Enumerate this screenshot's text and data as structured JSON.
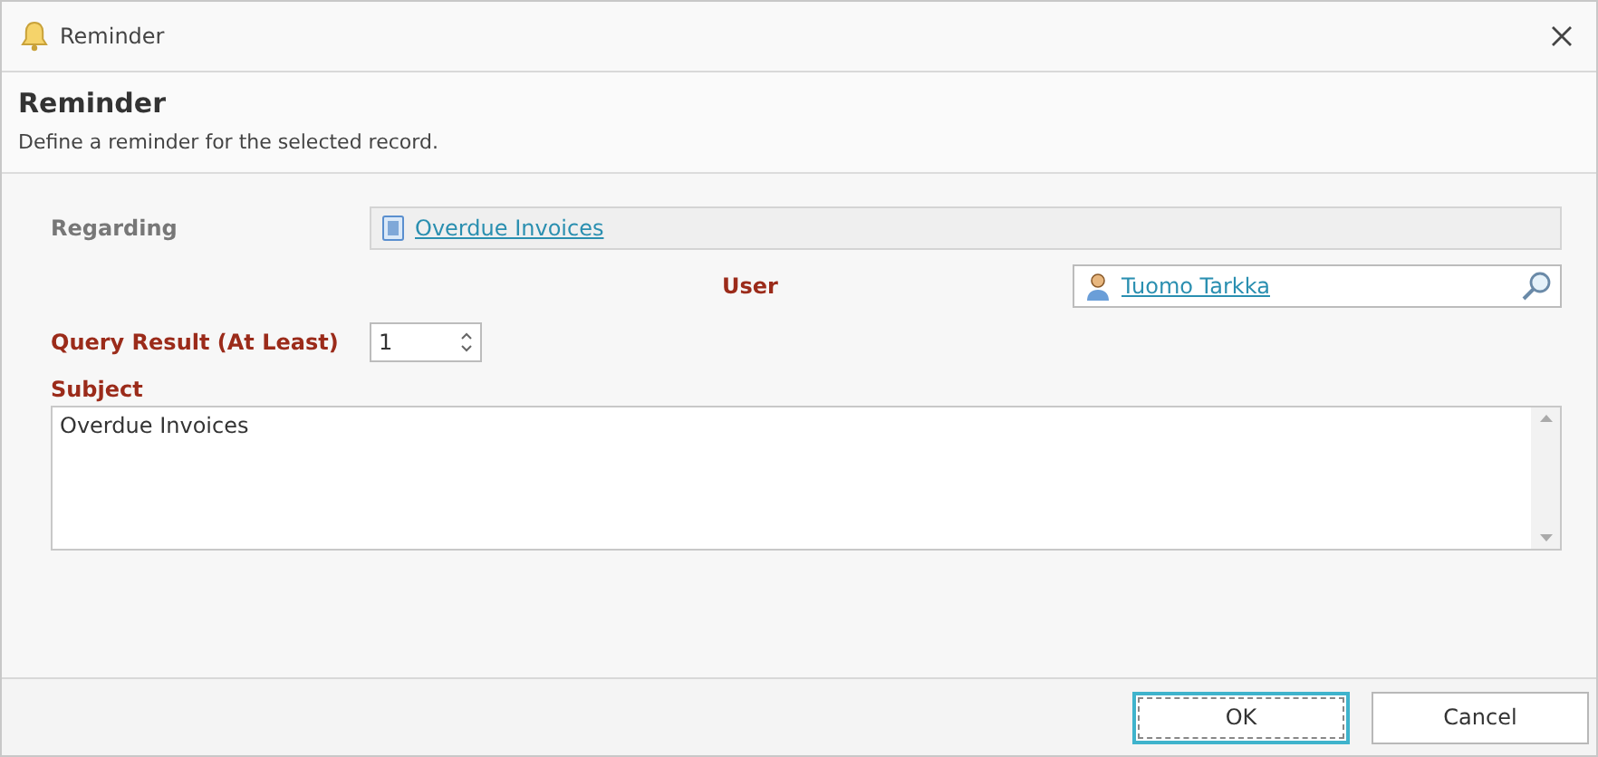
{
  "window": {
    "title": "Reminder"
  },
  "header": {
    "title": "Reminder",
    "description": "Define a reminder for the selected record."
  },
  "fields": [
    {
      "kind": "link",
      "label": "Regarding",
      "required": false,
      "value": "Overdue Invoices"
    },
    {
      "kind": "lookup",
      "label": "User",
      "required": true,
      "value": "Tuomo Tarkka"
    },
    {
      "kind": "spin",
      "label": "Query Result (At Least)",
      "required": true,
      "value": "1"
    },
    {
      "kind": "memo",
      "label": "Subject",
      "required": true,
      "value": "Overdue Invoices"
    }
  ],
  "buttons": [
    {
      "label": "OK",
      "focused": true
    },
    {
      "label": "Cancel",
      "focused": false
    }
  ]
}
